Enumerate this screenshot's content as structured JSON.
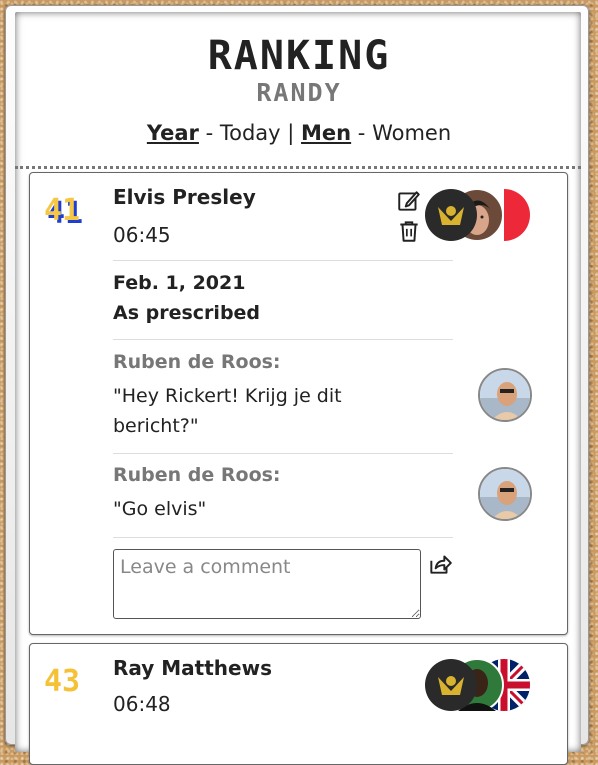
{
  "header": {
    "title": "RANKING",
    "subtitle": "RANDY",
    "period_active": "Year",
    "period_other": "Today",
    "gender_active": "Men",
    "gender_other": "Women",
    "dash": " - ",
    "pipe": " | "
  },
  "entries": [
    {
      "rank": "41",
      "name": "Elvis Presley",
      "time": "06:45",
      "date": "Feb. 1, 2021",
      "scaling": "As prescribed",
      "comments": [
        {
          "author": "Ruben de Roos:",
          "text": "\"Hey Rickert! Krijg je dit bericht?\""
        },
        {
          "author": "Ruben de Roos:",
          "text": "\"Go elvis\""
        }
      ],
      "comment_placeholder": "Leave a comment",
      "flag": "france"
    },
    {
      "rank": "43",
      "name": "Ray Matthews",
      "time": "06:48",
      "flag": "united-kingdom"
    }
  ],
  "icons": [
    "edit-icon",
    "trash-icon",
    "share-icon",
    "resize-icon"
  ],
  "colors": {
    "rank_fill": "#f6c744",
    "rank_shadow": "#1f3fd0",
    "text": "#222222",
    "muted": "#777777"
  }
}
